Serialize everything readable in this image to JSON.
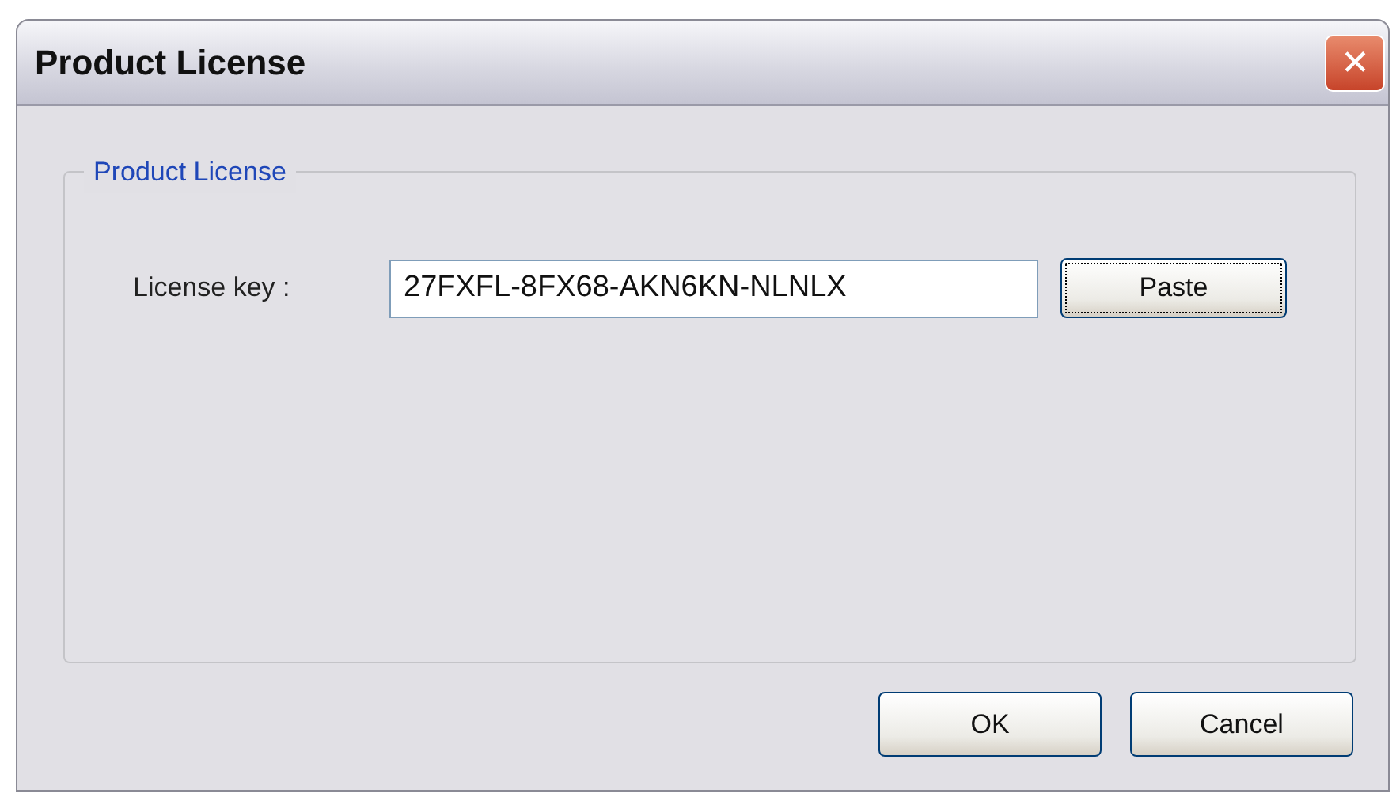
{
  "window": {
    "title": "Product License",
    "close_glyph": "✕"
  },
  "group": {
    "title": "Product License",
    "field": {
      "label": "License key :",
      "value": "27FXFL-8FX68-AKN6KN-NLNLX"
    },
    "paste_button": {
      "label": "Paste",
      "focused": true
    }
  },
  "buttons": [
    {
      "label": "OK",
      "focused": false
    },
    {
      "label": "Cancel",
      "focused": false
    }
  ]
}
